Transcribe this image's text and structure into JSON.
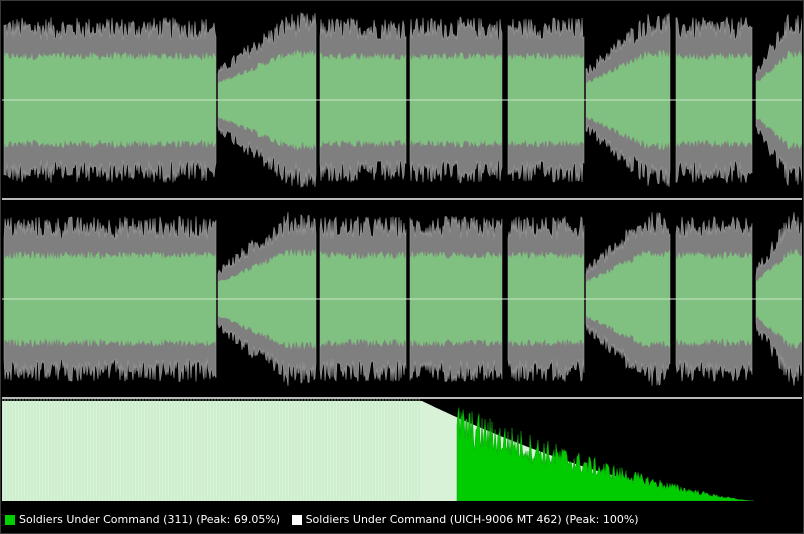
{
  "legend": {
    "items": [
      {
        "label": "Soldiers Under Command (311) (Peak: 69.05%)",
        "color": "#00d000"
      },
      {
        "label": "Soldiers Under Command (UICH-9006 MT 462) (Peak: 100%)",
        "color": "#ffffff"
      }
    ]
  },
  "colors": {
    "background": "#000000",
    "waveform_reference": "#7f7f7f",
    "waveform_compare": "#80c080",
    "centerline": "#c8e6c8",
    "spectrum_reference": "#d8f2d8",
    "spectrum_compare": "#00cc00"
  }
}
